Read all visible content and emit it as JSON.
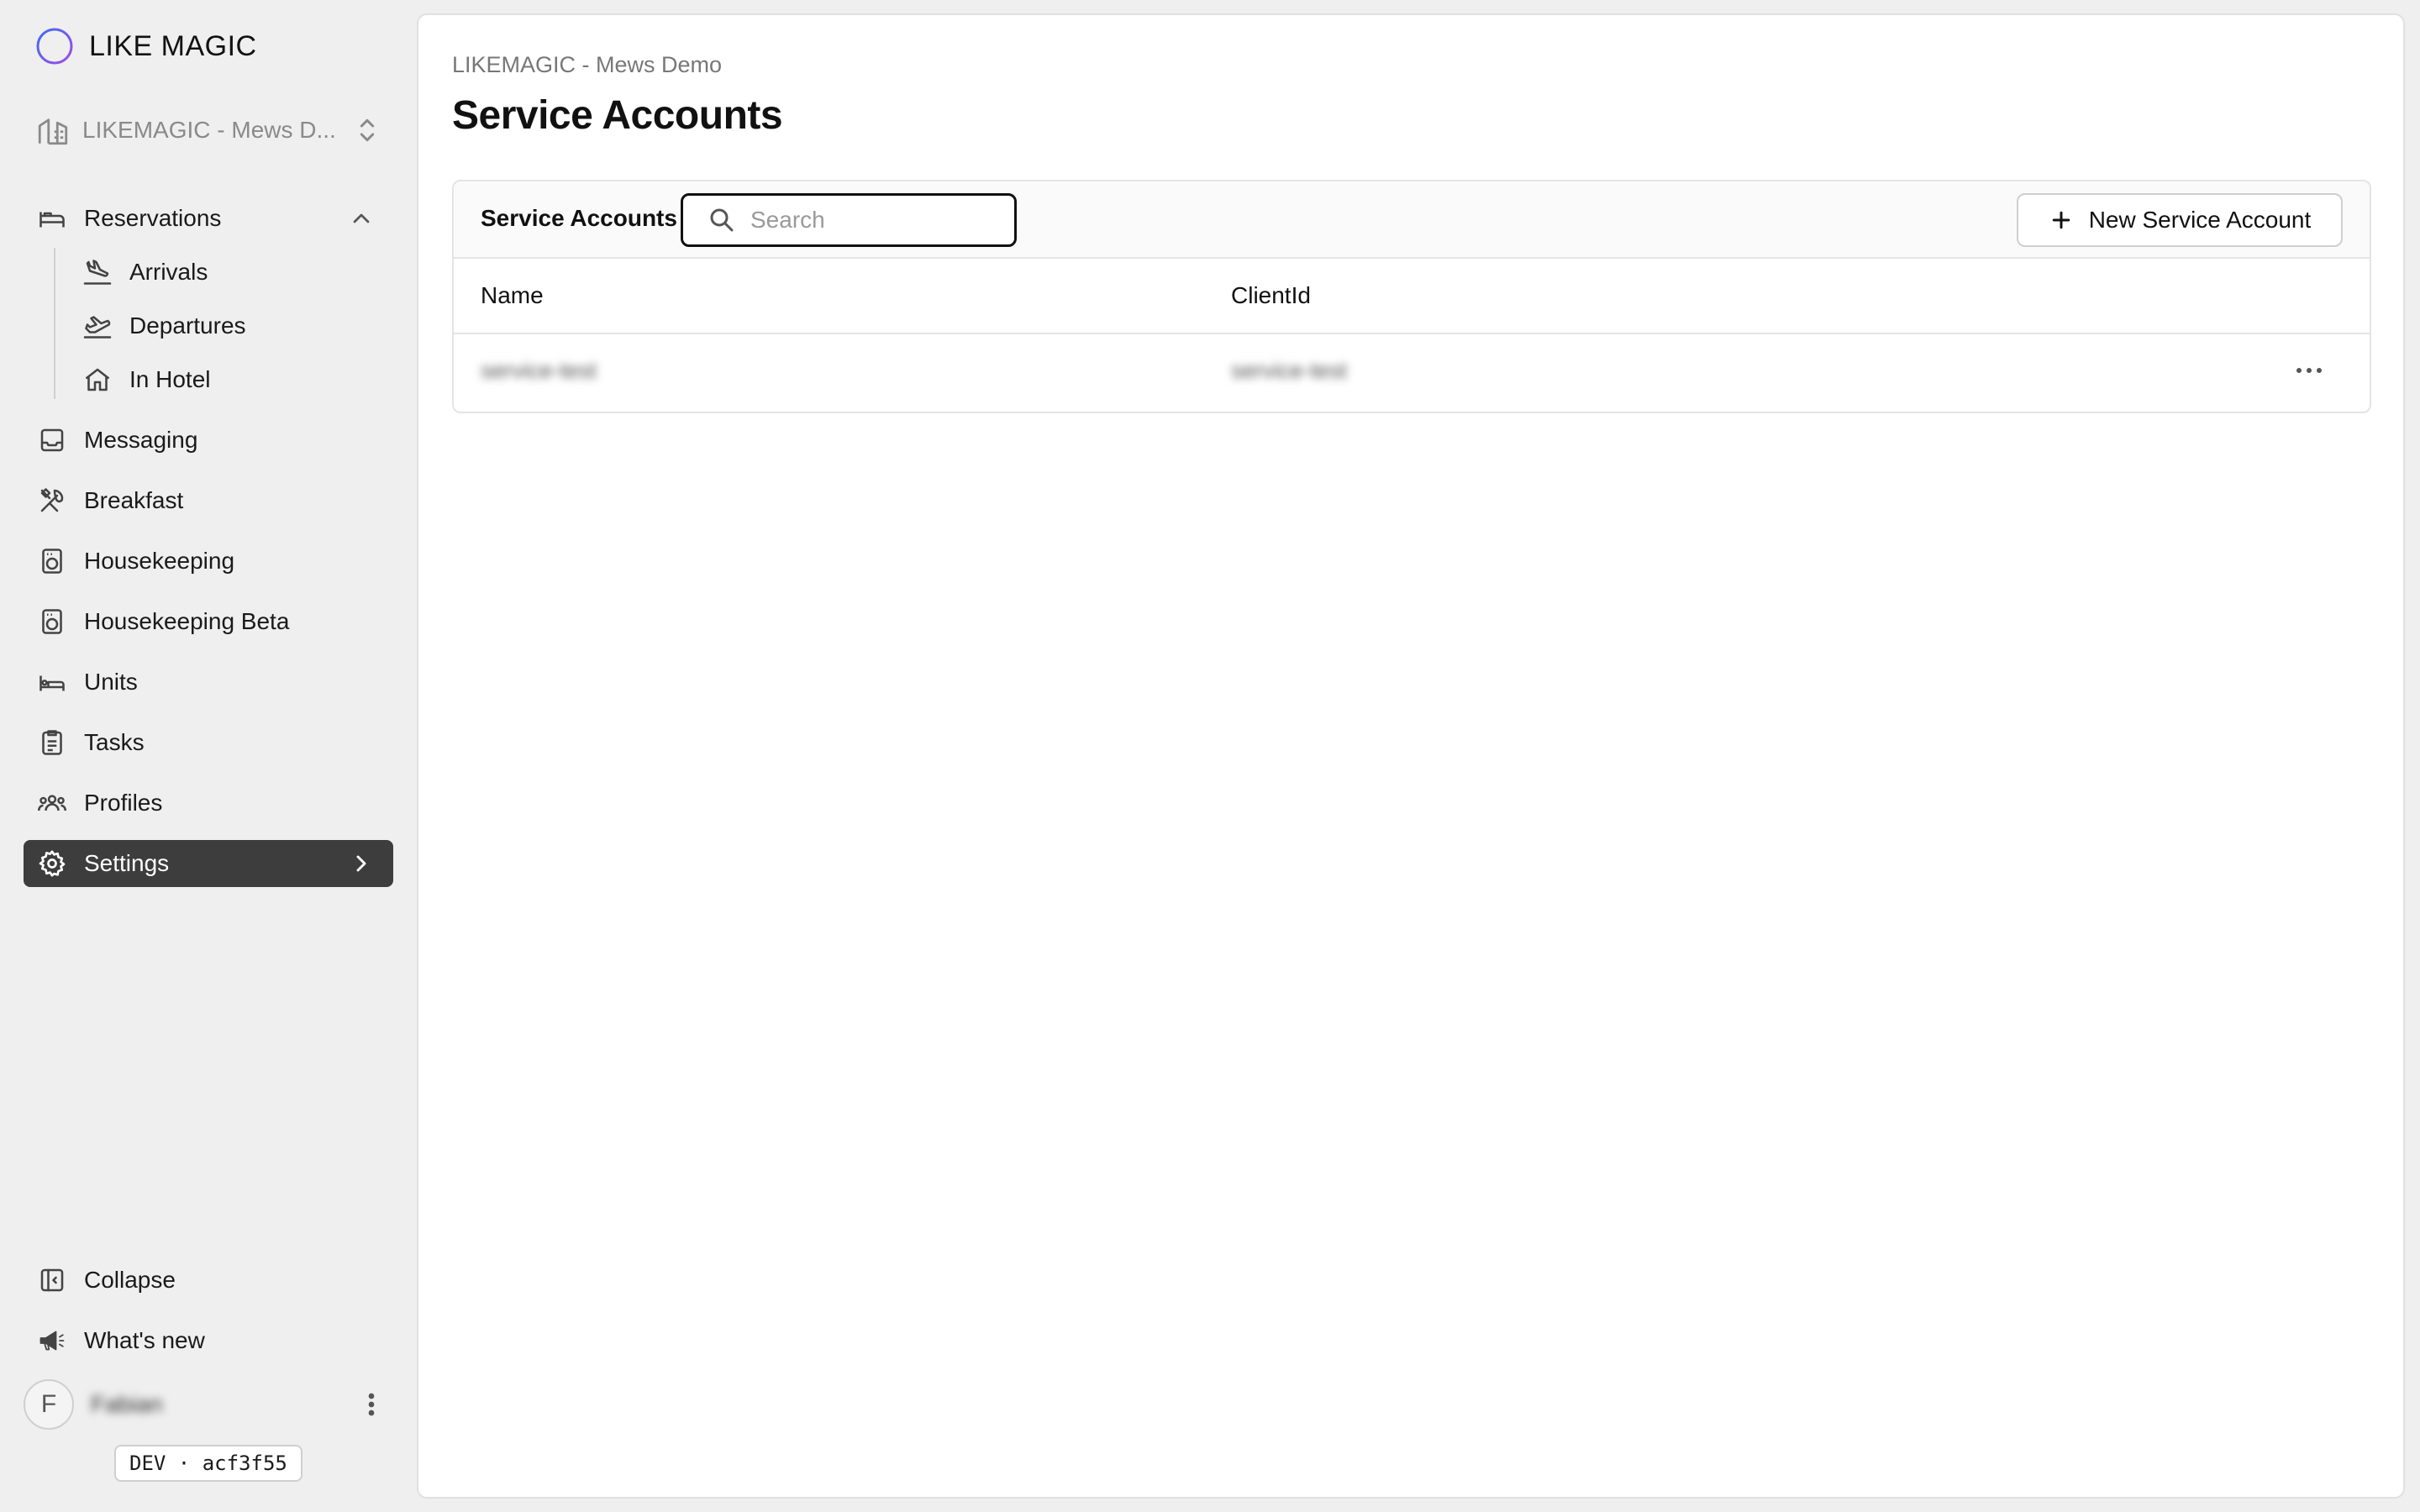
{
  "app": {
    "brand": "LIKE MAGIC"
  },
  "property": {
    "name": "LIKEMAGIC - Mews D..."
  },
  "sidebar": {
    "reservations": "Reservations",
    "arrivals": "Arrivals",
    "departures": "Departures",
    "in_hotel": "In Hotel",
    "messaging": "Messaging",
    "breakfast": "Breakfast",
    "housekeeping": "Housekeeping",
    "housekeeping_beta": "Housekeeping Beta",
    "units": "Units",
    "tasks": "Tasks",
    "profiles": "Profiles",
    "settings": "Settings",
    "collapse": "Collapse",
    "whats_new": "What's new"
  },
  "user": {
    "initial": "F",
    "name": "Fabian"
  },
  "version": "DEV · acf3f55",
  "main": {
    "breadcrumb": "LIKEMAGIC - Mews Demo",
    "title": "Service Accounts",
    "card_title": "Service Accounts",
    "search_placeholder": "Search",
    "new_button": "New Service Account",
    "columns": [
      "Name",
      "ClientId"
    ],
    "rows": [
      {
        "name": "service-test",
        "client_id": "service-test"
      }
    ]
  },
  "colors": {
    "active_nav_bg": "#3d3d3d",
    "page_bg": "#efefef",
    "logo_gradient": [
      "#3b6df0",
      "#a04ce8"
    ]
  }
}
